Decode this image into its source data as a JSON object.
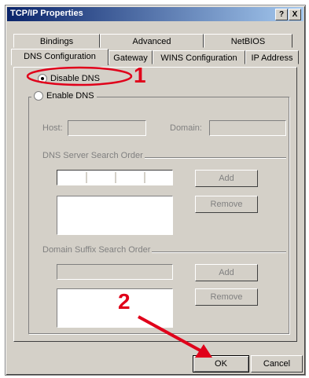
{
  "window": {
    "title": "TCP/IP Properties",
    "help_glyph": "?",
    "close_glyph": "X"
  },
  "tabs": {
    "row1": [
      "Bindings",
      "Advanced",
      "NetBIOS"
    ],
    "row2": [
      "DNS Configuration",
      "Gateway",
      "WINS Configuration",
      "IP Address"
    ],
    "active": "DNS Configuration"
  },
  "dns": {
    "disable_label": "Disable DNS",
    "enable_label": "Enable DNS",
    "selected": "Disable DNS",
    "host_label": "Host:",
    "domain_label": "Domain:",
    "server_order_label": "DNS Server Search Order",
    "suffix_order_label": "Domain Suffix Search Order",
    "add_label": "Add",
    "remove_label": "Remove"
  },
  "footer": {
    "ok_label": "OK",
    "cancel_label": "Cancel"
  },
  "annotations": {
    "step1": "1",
    "step2": "2",
    "color": "#e0001a"
  }
}
